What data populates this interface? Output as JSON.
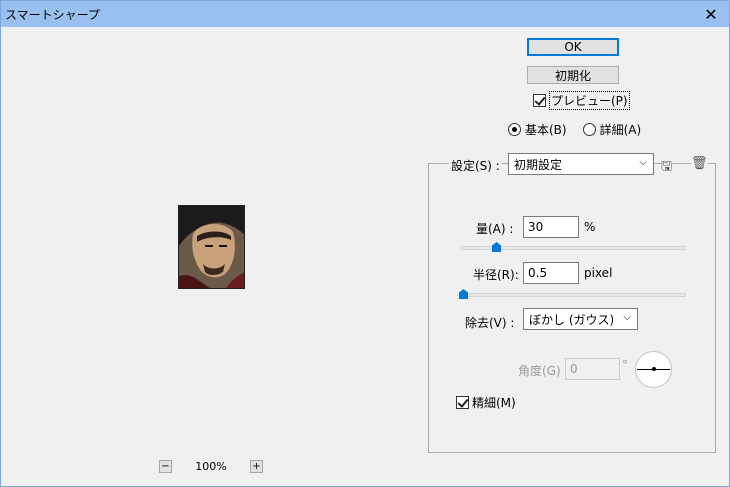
{
  "window": {
    "title": "スマートシャープ"
  },
  "preview": {
    "zoom_out": "−",
    "zoom_value": "100%",
    "zoom_in": "+"
  },
  "buttons": {
    "ok": "OK",
    "reset": "初期化"
  },
  "preview_toggle": {
    "label": "プレビュー(P)",
    "checked": true
  },
  "mode": {
    "basic": "基本(B)",
    "advanced": "詳細(A)",
    "selected": "basic"
  },
  "settings": {
    "label": "設定(S) :",
    "value": "初期設定"
  },
  "amount": {
    "label": "量(A) :",
    "value": "30",
    "unit": "%"
  },
  "radius": {
    "label": "半径(R):",
    "value": "0.5",
    "unit": "pixel"
  },
  "remove": {
    "label": "除去(V) :",
    "value": "ぼかし (ガウス)"
  },
  "angle": {
    "label": "角度(G)",
    "value": "0",
    "unit": "°"
  },
  "more_accurate": {
    "label": "精細(M)",
    "checked": true
  },
  "icons": {
    "save": "save-preset-icon",
    "delete": "trash-icon",
    "close": "close-icon"
  }
}
